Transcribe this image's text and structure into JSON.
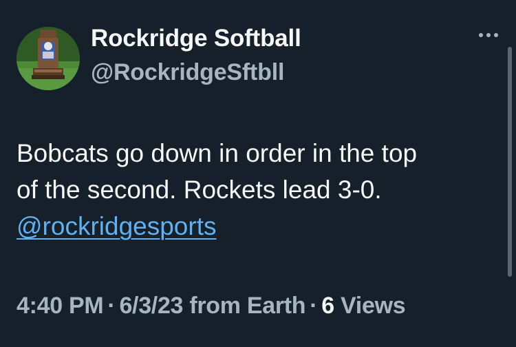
{
  "author": {
    "display_name": "Rockridge Softball",
    "handle": "@RockridgeSftbll",
    "avatar_icon": "trophy-on-grass-icon"
  },
  "more_icon": "ellipsis-icon",
  "tweet": {
    "line1": "Bobcats go down in order in the top",
    "line2": "of the second. Rockets lead 3-0.",
    "mention": "@rockridgesports"
  },
  "meta": {
    "time": "4:40 PM",
    "date": "6/3/23",
    "source": "from Earth",
    "separator": "·",
    "views_count": "6",
    "views_label": "Views"
  },
  "colors": {
    "background": "#15202b",
    "primary_text": "#f7f9f9",
    "secondary_text": "#a8b4bf",
    "link": "#5fb1f0"
  }
}
